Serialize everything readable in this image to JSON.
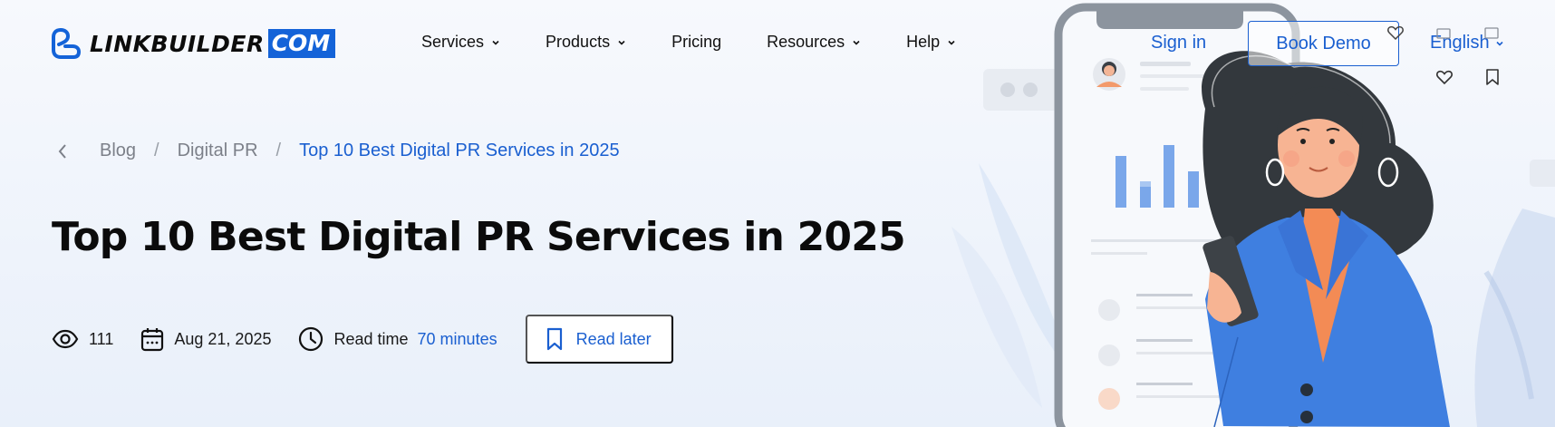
{
  "brand": {
    "name": "LINKBUILDER",
    "suffix": "COM",
    "accent": "#1463d8"
  },
  "nav": {
    "items": [
      {
        "label": "Services",
        "has_dropdown": true
      },
      {
        "label": "Products",
        "has_dropdown": true
      },
      {
        "label": "Pricing",
        "has_dropdown": false
      },
      {
        "label": "Resources",
        "has_dropdown": true
      },
      {
        "label": "Help",
        "has_dropdown": true
      }
    ],
    "sign_in": "Sign in",
    "book_demo": "Book Demo",
    "language": "English"
  },
  "breadcrumb": {
    "items": [
      "Blog",
      "Digital PR"
    ],
    "current": "Top 10 Best Digital PR Services in 2025",
    "separator": "/"
  },
  "article": {
    "title": "Top 10 Best Digital PR Services in 2025",
    "views": "111",
    "date": "Aug 21, 2025",
    "read_time_label": "Read time",
    "read_time_value": "70 minutes",
    "read_later": "Read later"
  },
  "icons": {
    "views": "eye-icon",
    "date": "calendar-icon",
    "read_time": "clock-icon",
    "read_later": "bookmark-icon",
    "like": "heart-icon"
  },
  "colors": {
    "link": "#1a5fd0",
    "muted": "#7c8089",
    "text": "#111111"
  }
}
